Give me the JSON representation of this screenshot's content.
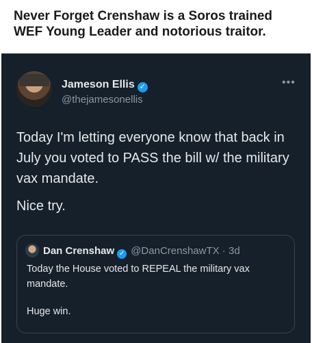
{
  "caption": "Never Forget Crenshaw is a Soros trained WEF Young Leader and notorious traitor.",
  "tweet": {
    "author_name": "Jameson Ellis",
    "handle": "@thejamesonellis",
    "more_icon": "more-icon",
    "verified_glyph": "✓",
    "paragraph1": "Today I'm letting everyone know that back in July you voted to PASS the bill w/ the military vax mandate.",
    "paragraph2": "Nice try."
  },
  "quoted": {
    "author_name": "Dan Crenshaw",
    "handle": "@DanCrenshawTX · 3d",
    "verified_glyph": "✓",
    "line1": "Today the House voted to REPEAL the military vax mandate.",
    "line2": "Huge win."
  },
  "colors": {
    "background": "#15202b",
    "accent": "#1d9bf0",
    "text": "#e7e9ea",
    "muted": "#8b98a5"
  }
}
